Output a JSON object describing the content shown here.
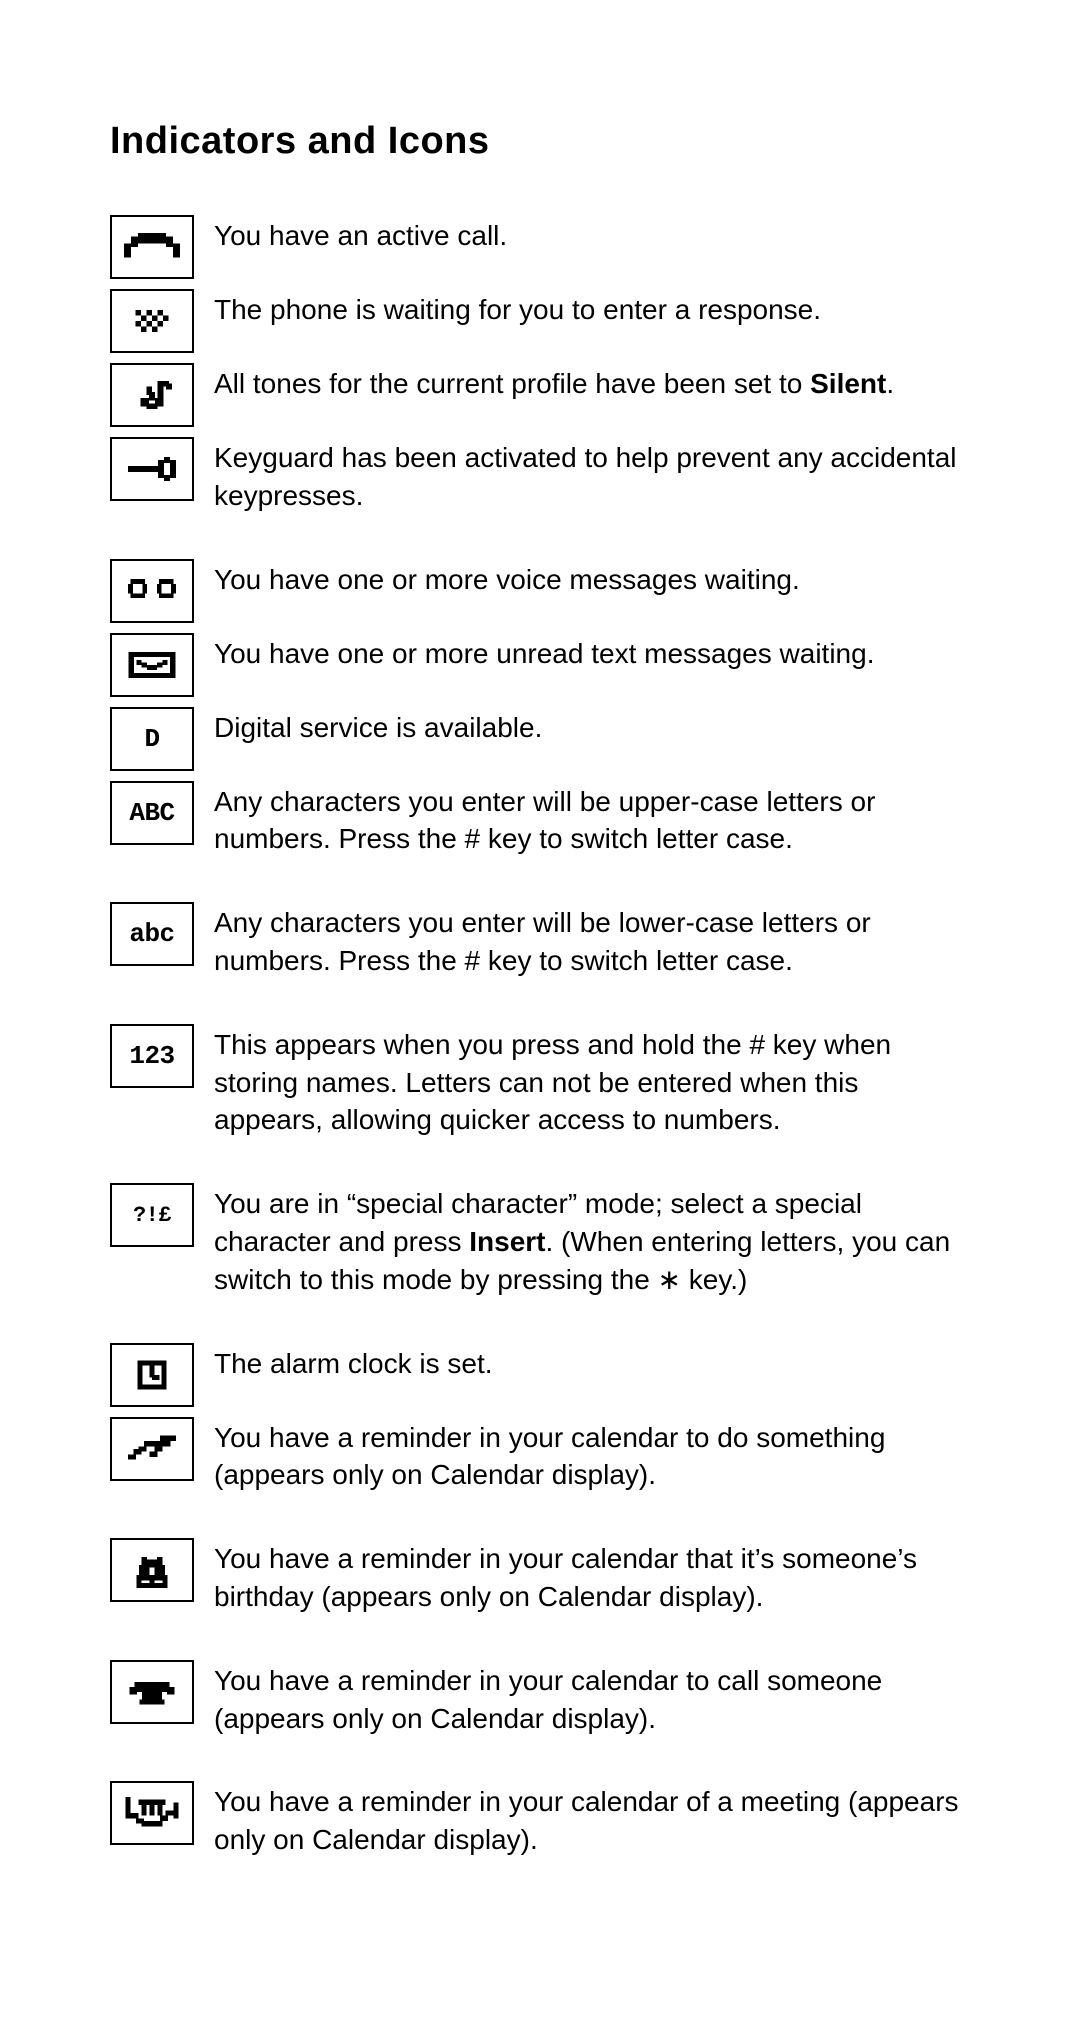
{
  "title": "Indicators and Icons",
  "rows": {
    "r0": {
      "desc_pre": "You have an active call.",
      "bold": "",
      "desc_post": ""
    },
    "r1": {
      "desc_pre": "The phone is waiting for you to enter a response.",
      "bold": "",
      "desc_post": ""
    },
    "r2": {
      "desc_pre": "All tones for the current profile have been set to ",
      "bold": "Silent",
      "desc_post": "."
    },
    "r3": {
      "desc_pre": "Keyguard has been activated to help prevent any accidental keypresses.",
      "bold": "",
      "desc_post": ""
    },
    "r4": {
      "desc_pre": "You have one or more voice messages waiting.",
      "bold": "",
      "desc_post": ""
    },
    "r5": {
      "desc_pre": "You have one or more unread text messages waiting.",
      "bold": "",
      "desc_post": ""
    },
    "r6": {
      "desc_pre": "Digital service is available.",
      "bold": "",
      "desc_post": ""
    },
    "r7": {
      "desc_pre": "Any characters you enter will be upper-case letters or numbers. Press the # key to switch letter case.",
      "bold": "",
      "desc_post": ""
    },
    "r8": {
      "desc_pre": "Any characters you enter will be lower-case letters or numbers. Press the # key to switch letter case.",
      "bold": "",
      "desc_post": ""
    },
    "r9": {
      "desc_pre": "This appears when you press and hold the # key when storing names. Letters can not be entered when this appears, allowing quicker access to numbers.",
      "bold": "",
      "desc_post": ""
    },
    "r10": {
      "desc_pre": "You are in “special character” mode; select a special character and press ",
      "bold": "Insert",
      "desc_post": ". (When entering letters, you can switch to this mode by pressing the ∗ key.)"
    },
    "r11": {
      "desc_pre": "The alarm clock is set.",
      "bold": "",
      "desc_post": ""
    },
    "r12": {
      "desc_pre": "You have a reminder in your calendar to do something (appears only on Calendar display).",
      "bold": "",
      "desc_post": ""
    },
    "r13": {
      "desc_pre": "You have a reminder in your calendar that it’s some­one’s birthday (appears only on Calendar display).",
      "bold": "",
      "desc_post": ""
    },
    "r14": {
      "desc_pre": "You have a reminder in your calendar to call someone (appears only on Calendar display).",
      "bold": "",
      "desc_post": ""
    },
    "r15": {
      "desc_pre": "You have a reminder in your calendar of a meeting (appears only on Calendar display).",
      "bold": "",
      "desc_post": ""
    }
  },
  "icon_labels": {
    "abc_upper": "ABC",
    "abc_lower": "abc",
    "num": "123",
    "special": "?!£",
    "digital": "D"
  }
}
